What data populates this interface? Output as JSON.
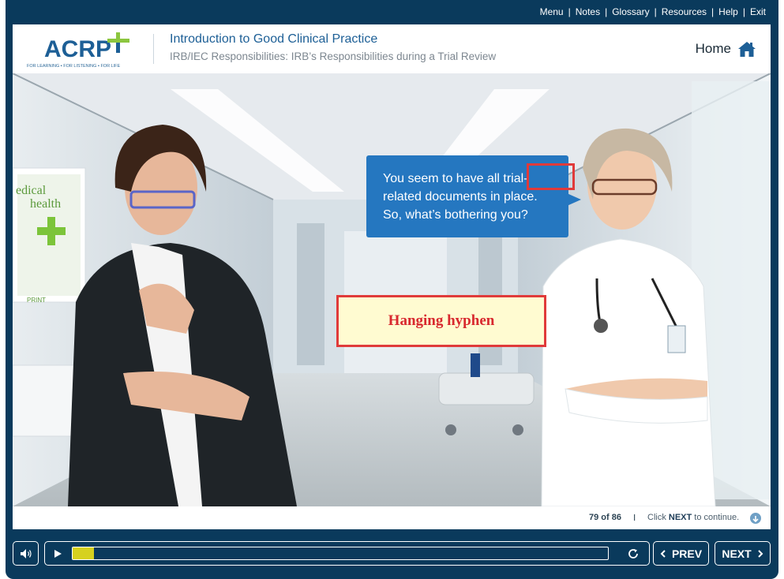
{
  "top_menu": [
    "Menu",
    "Notes",
    "Glossary",
    "Resources",
    "Help",
    "Exit"
  ],
  "logo": {
    "text": "ACRP",
    "tagline": "FOR LEARNING ▪ FOR LISTENING ▪ FOR LIFE"
  },
  "course": {
    "title": "Introduction to Good Clinical Practice",
    "subtitle": "IRB/IEC Responsibilities: IRB’s Responsibilities during a Trial Review"
  },
  "home_label": "Home",
  "scene": {
    "poster_line1": "edical",
    "poster_line2": "health",
    "poster_print": "PRINT",
    "speech": [
      "You seem to have all trial-",
      "related documents in place.",
      "So, what’s bothering you?"
    ]
  },
  "annotation": "Hanging hyphen",
  "status": {
    "page": "79 of 86",
    "sep": "I",
    "hint_pre": "Click ",
    "hint_bold": "NEXT",
    "hint_post": " to continue."
  },
  "controls": {
    "prev": "PREV",
    "next": "NEXT",
    "progress": 0.04
  },
  "colors": {
    "frame": "#0a3a5c",
    "accent": "#1d5f96",
    "bubble": "#2577c0",
    "progress": "#d6d11f",
    "annotation": "#e03a3a"
  }
}
